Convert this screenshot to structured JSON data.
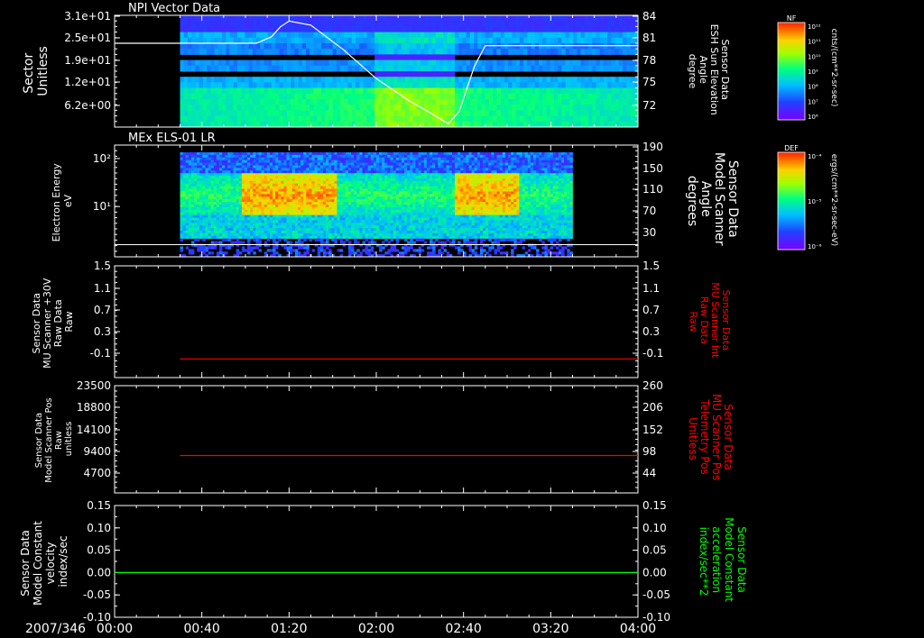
{
  "date_label": "2007/346",
  "colors": {
    "axis": "#ffffff",
    "red": "#ff0000",
    "green": "#00ff00",
    "sweep": "#ffffff"
  },
  "xaxis": {
    "range": [
      "00:00",
      "04:00"
    ],
    "ticks": [
      "00:00",
      "00:40",
      "01:20",
      "02:00",
      "02:40",
      "03:20",
      "04:00"
    ]
  },
  "panels": [
    {
      "title": "NPI Vector Data",
      "left_label": [
        "Sector",
        "Unitless"
      ],
      "left_ticks": [
        "3.1e+01",
        "2.5e+01",
        "1.9e+01",
        "1.2e+01",
        "6.2e+00"
      ],
      "right_label": [
        "Sensor Data",
        "ESH Sun Elevation",
        "Angle",
        "degree"
      ],
      "right_label_color": "#ffffff",
      "right_ticks": [
        "84",
        "81",
        "78",
        "75",
        "72"
      ],
      "colorbar": {
        "label": "NF",
        "unit": "cnts/(cm**2-sr-sec)",
        "ticks": [
          "10¹²",
          "10¹¹",
          "10¹⁰",
          "10⁹",
          "10⁸",
          "10⁷",
          "10⁶"
        ]
      }
    },
    {
      "title": "MEx ELS-01 LR",
      "left_label": [
        "Electron Energy",
        "eV"
      ],
      "left_ticks": [
        "10²",
        "10¹"
      ],
      "right_label": [
        "Sensor Data",
        "Model Scanner",
        "Angle",
        "degrees"
      ],
      "right_label_color": "#ffffff",
      "right_ticks": [
        "190",
        "150",
        "110",
        "70",
        "30"
      ],
      "colorbar": {
        "label": "DEF",
        "unit": "ergs/(cm**2-sr-sec-eV)",
        "ticks": [
          "10⁻⁴",
          "10⁻⁵",
          "10⁻⁶"
        ]
      }
    },
    {
      "title": "",
      "left_label": [
        "Sensor Data",
        "MU Scanner +30V",
        "Raw Data",
        "Raw"
      ],
      "left_ticks": [
        "1.5",
        "1.1",
        "0.7",
        "0.3",
        "-0.1"
      ],
      "right_label": [
        "Sensor Data",
        "MU Scanner Int",
        "Raw Data",
        "Raw"
      ],
      "right_label_color": "#ff0000",
      "right_ticks": [
        "1.5",
        "1.1",
        "0.7",
        "0.3",
        "-0.1"
      ]
    },
    {
      "title": "",
      "left_label": [
        "Sensor Data",
        "Model Scanner Pos",
        "Raw",
        "unitless"
      ],
      "left_ticks": [
        "23500",
        "18800",
        "14100",
        "9400",
        "4700"
      ],
      "right_label": [
        "Sensor Data",
        "MU Scanner Pos",
        "Telemetry Pos",
        "Unitless"
      ],
      "right_label_color": "#ff0000",
      "right_ticks": [
        "260",
        "206",
        "152",
        "98",
        "44"
      ]
    },
    {
      "title": "",
      "left_label": [
        "Sensor Data",
        "Model Constant",
        "velocity",
        "index/sec"
      ],
      "left_ticks": [
        "0.15",
        "0.10",
        "0.05",
        "0.00",
        "-0.05",
        "-0.10"
      ],
      "right_label": [
        "Sensor Data",
        "Model Constant",
        "acceleration",
        "index/sec**2"
      ],
      "right_label_color": "#00ff00",
      "right_ticks": [
        "0.15",
        "0.10",
        "0.05",
        "0.00",
        "-0.05",
        "-0.10"
      ]
    }
  ],
  "chart_data": [
    {
      "type": "heatmap",
      "title": "NPI Vector Data",
      "ylabel": "Sector Unitless",
      "y2label": "Sensor Data ESH Sun Elevation Angle degree",
      "data_start_time": "00:30",
      "data_end_time": "04:00",
      "overlay_line": {
        "name": "ESH Sun Elevation Angle",
        "x": [
          "00:00",
          "00:30",
          "01:05",
          "01:12",
          "01:16",
          "01:20",
          "01:30",
          "01:45",
          "02:00",
          "02:15",
          "02:25",
          "02:33",
          "02:38",
          "02:45",
          "02:50",
          "04:00"
        ],
        "y": [
          80.8,
          80.8,
          80.8,
          81.6,
          82.8,
          83.5,
          83.0,
          80.0,
          76.5,
          73.8,
          72.3,
          71.0,
          72.5,
          78.0,
          80.5,
          80.5
        ]
      }
    },
    {
      "type": "heatmap",
      "title": "MEx ELS-01 LR",
      "ylabel": "Electron Energy eV",
      "y2label": "Sensor Data Model Scanner Angle degrees",
      "yscale": "log",
      "data_start_time": "00:30",
      "data_end_time": "03:30",
      "overlay_line": {
        "name": "Model Scanner Angle",
        "x": [
          "00:00",
          "04:00"
        ],
        "y": [
          12,
          12
        ]
      }
    },
    {
      "type": "line",
      "series": [
        {
          "name": "MU Scanner Int Raw Data Raw",
          "x": [
            "00:30",
            "04:00"
          ],
          "y": [
            0,
            0
          ],
          "color": "#ff0000"
        }
      ],
      "ylim": [
        -0.3,
        1.5
      ]
    },
    {
      "type": "line",
      "series": [
        {
          "name": "MU Scanner Pos Telemetry Pos Unitless",
          "x": [
            "00:30",
            "04:00"
          ],
          "y": [
            8200,
            8200
          ],
          "color": "#ff0000"
        }
      ],
      "ylim": [
        0,
        23500
      ]
    },
    {
      "type": "line",
      "series": [
        {
          "name": "Model Constant acceleration index/sec**2",
          "x": [
            "00:00",
            "04:00"
          ],
          "y": [
            0.0,
            0.0
          ],
          "color": "#00ff00"
        }
      ],
      "ylim": [
        -0.1,
        0.15
      ]
    }
  ]
}
